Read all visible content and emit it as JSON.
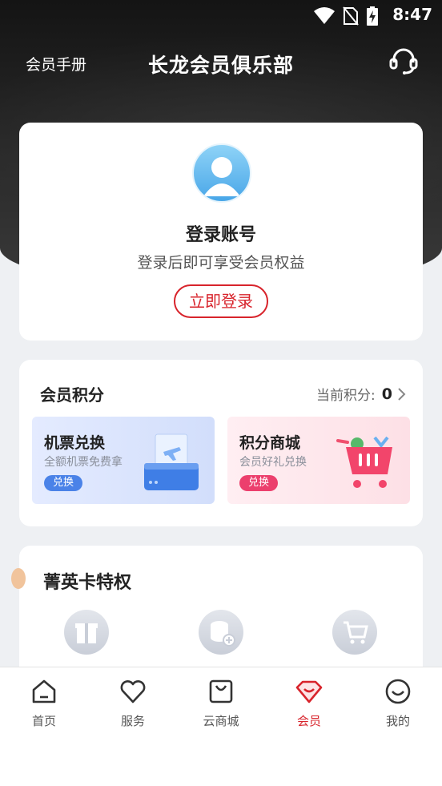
{
  "status_bar": {
    "time": "8:47"
  },
  "header": {
    "manual_label": "会员手册",
    "title": "长龙会员俱乐部"
  },
  "login": {
    "title": "登录账号",
    "subtitle": "登录后即可享受会员权益",
    "button_label": "立即登录"
  },
  "points": {
    "title": "会员积分",
    "current_label": "当前积分:",
    "current_value": "0",
    "tiles": [
      {
        "title": "机票兑换",
        "subtitle": "全额机票免费拿",
        "badge": "兑换"
      },
      {
        "title": "积分商城",
        "subtitle": "会员好礼兑换",
        "badge": "兑换"
      }
    ]
  },
  "elite": {
    "title": "菁英卡特权"
  },
  "tabs": [
    {
      "label": "首页"
    },
    {
      "label": "服务"
    },
    {
      "label": "云商城"
    },
    {
      "label": "会员"
    },
    {
      "label": "我的"
    }
  ],
  "colors": {
    "accent": "#d8242c",
    "header_bg": "#1e1e1e",
    "page_bg": "#eef0f3"
  }
}
